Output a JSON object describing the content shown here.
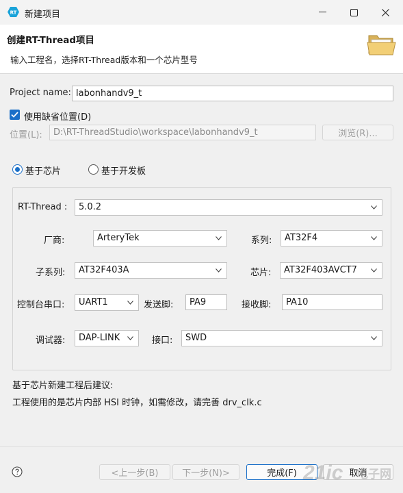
{
  "window": {
    "title": "新建项目"
  },
  "header": {
    "title": "创建RT-Thread项目",
    "description": "输入工程名，选择RT-Thread版本和一个芯片型号"
  },
  "project_name": {
    "label": "Project name:",
    "value": "labonhandv9_t"
  },
  "use_default_location": {
    "label": "使用缺省位置(D)",
    "checked": true
  },
  "location": {
    "label": "位置(L):",
    "value": "D:\\RT-ThreadStudio\\workspace\\labonhandv9_t",
    "browse_label": "浏览(R)..."
  },
  "mode": {
    "chip_label": "基于芯片",
    "board_label": "基于开发板",
    "selected": "chip"
  },
  "rt_thread": {
    "label": "RT-Thread :",
    "value": "5.0.2"
  },
  "vendor": {
    "label": "厂商:",
    "value": "ArteryTek"
  },
  "series": {
    "label": "系列:",
    "value": "AT32F4"
  },
  "sub_series": {
    "label": "子系列:",
    "value": "AT32F403A"
  },
  "chip": {
    "label": "芯片:",
    "value": "AT32F403AVCT7"
  },
  "console": {
    "label": "控制台串口:",
    "value": "UART1",
    "tx_label": "发送脚:",
    "tx_value": "PA9",
    "rx_label": "接收脚:",
    "rx_value": "PA10"
  },
  "debugger": {
    "label": "调试器:",
    "value": "DAP-LINK",
    "interface_label": "接口:",
    "interface_value": "SWD"
  },
  "advice": {
    "title": "基于芯片新建工程后建议:",
    "text": "工程使用的是芯片内部 HSI 时钟，如需修改，请完善 drv_clk.c"
  },
  "buttons": {
    "back": "<上一步(B)",
    "next": "下一步(N)>",
    "finish": "完成(F)",
    "cancel": "取消"
  },
  "watermark": {
    "line1": "21ic",
    "line2": "电子网"
  },
  "colors": {
    "accent": "#1a6fc8",
    "header_bg": "#ffffff",
    "dialog_bg": "#f0f0f0"
  },
  "icons": [
    "app-icon",
    "minimize-icon",
    "maximize-icon",
    "close-icon",
    "folder-icon",
    "checkmark-icon",
    "chevron-down-icon",
    "help-icon"
  ]
}
